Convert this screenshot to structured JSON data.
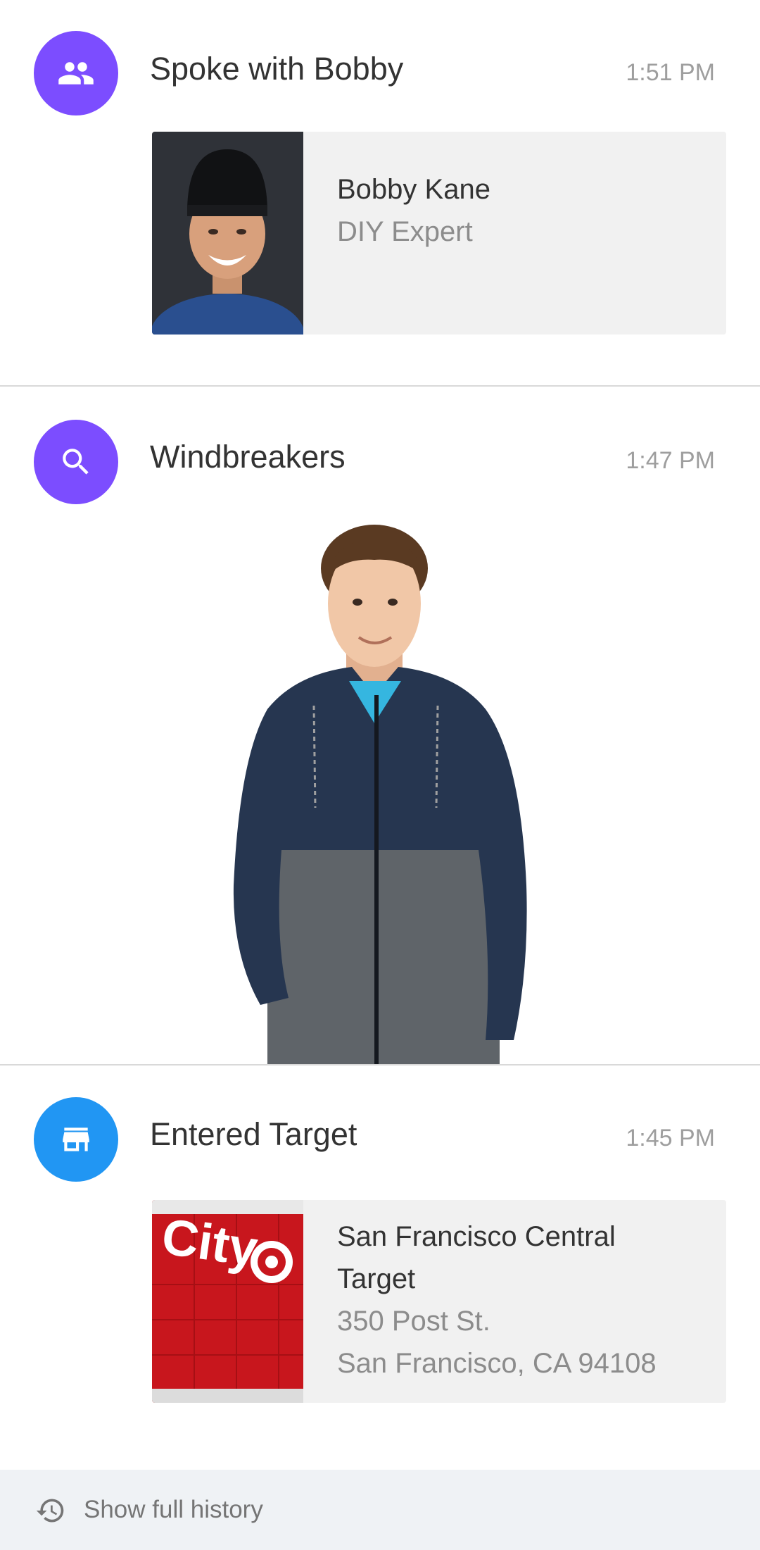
{
  "timeline": {
    "items": [
      {
        "title": "Spoke with Bobby",
        "time": "1:51 PM",
        "icon": "people-icon",
        "icon_color": "#7c4dff",
        "card": {
          "name": "Bobby Kane",
          "subtitle": "DIY Expert"
        }
      },
      {
        "title": "Windbreakers",
        "time": "1:47 PM",
        "icon": "search-icon",
        "icon_color": "#7c4dff"
      },
      {
        "title": "Entered Target",
        "time": "1:45 PM",
        "icon": "store-icon",
        "icon_color": "#2196f3",
        "card": {
          "name": "San Francisco Central Target",
          "address_line1": "350 Post St.",
          "address_line2": "San Francisco, CA 94108"
        }
      }
    ]
  },
  "footer": {
    "label": "Show full history",
    "icon": "history-icon"
  }
}
